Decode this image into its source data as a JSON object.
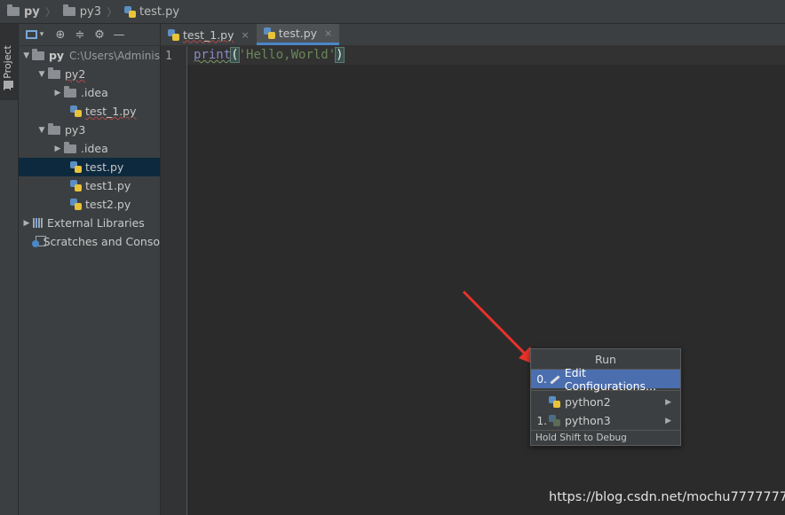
{
  "breadcrumb": {
    "items": [
      "py",
      "py3",
      "test.py"
    ]
  },
  "sidebar": {
    "tab_label": "1: Project"
  },
  "project_tree": {
    "rows": [
      {
        "label": "py",
        "sub": "C:\\Users\\Adminis"
      },
      {
        "label": "py2"
      },
      {
        "label": ".idea"
      },
      {
        "label": "test_1.py"
      },
      {
        "label": "py3"
      },
      {
        "label": ".idea"
      },
      {
        "label": "test.py"
      },
      {
        "label": "test1.py"
      },
      {
        "label": "test2.py"
      },
      {
        "label": "External Libraries"
      },
      {
        "label": "Scratches and Conso"
      }
    ]
  },
  "editor": {
    "tabs": [
      {
        "label": "test_1.py",
        "close": "×"
      },
      {
        "label": "test.py",
        "close": "×"
      }
    ],
    "line_number": "1",
    "code": {
      "func": "print",
      "open": "(",
      "string": "'Hello,World'",
      "close": ")"
    }
  },
  "run_menu": {
    "title": "Run",
    "items": [
      {
        "num": "0.",
        "label": "Edit Configurations..."
      },
      {
        "num": "",
        "label": "python2"
      },
      {
        "num": "1.",
        "label": "python3"
      }
    ],
    "footer": "Hold Shift to Debug"
  },
  "watermark": "https://blog.csdn.net/mochu7777777",
  "colors": {
    "accent": "#4b6eaf",
    "selection": "#0d293e",
    "arrow": "#e8322a"
  }
}
